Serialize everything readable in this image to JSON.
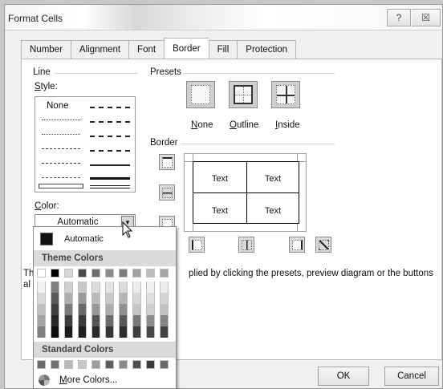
{
  "window": {
    "title": "Format Cells",
    "help_glyph": "?",
    "close_glyph": "☒"
  },
  "tabs": [
    "Number",
    "Alignment",
    "Font",
    "Border",
    "Fill",
    "Protection"
  ],
  "line": {
    "section": "Line",
    "style_label": "Style:",
    "none_label": "None",
    "color_label": "Color:",
    "color_value": "Automatic"
  },
  "presets": {
    "section": "Presets",
    "items": [
      {
        "label_u": "N",
        "label_rest": "one"
      },
      {
        "label_u": "O",
        "label_rest": "utline"
      },
      {
        "label_u": "I",
        "label_rest": "nside"
      }
    ]
  },
  "border": {
    "section": "Border",
    "cells": [
      "Text",
      "Text",
      "Text",
      "Text"
    ]
  },
  "footnote": {
    "left_visible": "Th",
    "left_visible2": "al",
    "text": "plied by clicking the presets, preview diagram or the buttons"
  },
  "buttons": {
    "ok": "OK",
    "cancel": "Cancel"
  },
  "palette": {
    "automatic_label": "Automatic",
    "theme_header": "Theme Colors",
    "standard_header": "Standard Colors",
    "more_u": "M",
    "more_rest": "ore Colors...",
    "theme_top_row": [
      "#ffffff",
      "#000000",
      "#d8d8d8",
      "#4a4a4a",
      "#6e6e6e",
      "#8c8c8c",
      "#7a7a7a",
      "#a2a2a2",
      "#bcbcbc",
      "#a6a6a6"
    ],
    "theme_columns": [
      [
        "#f2f2f2",
        "#d9d9d9",
        "#bfbfbf",
        "#a6a6a6",
        "#7f7f7f"
      ],
      [
        "#7f7f7f",
        "#595959",
        "#3f3f3f",
        "#262626",
        "#0d0d0d"
      ],
      [
        "#d0d0d0",
        "#aeaeae",
        "#7a7a7a",
        "#3d3d3d",
        "#1a1a1a"
      ],
      [
        "#c8c8c8",
        "#9a9a9a",
        "#6a6a6a",
        "#3a3a3a",
        "#1e1e1e"
      ],
      [
        "#dcdcdc",
        "#bababa",
        "#979797",
        "#555555",
        "#2a2a2a"
      ],
      [
        "#e4e4e4",
        "#c9c9c9",
        "#adadad",
        "#6c6c6c",
        "#363636"
      ],
      [
        "#dadada",
        "#b5b5b5",
        "#909090",
        "#5a5a5a",
        "#2d2d2d"
      ],
      [
        "#ececec",
        "#d8d8d8",
        "#c5c5c5",
        "#7a7a7a",
        "#3e3e3e"
      ],
      [
        "#f0f0f0",
        "#e0e0e0",
        "#d0d0d0",
        "#8c8c8c",
        "#464646"
      ],
      [
        "#ebebeb",
        "#d6d6d6",
        "#c2c2c2",
        "#858585",
        "#424242"
      ]
    ],
    "standard_row": [
      "#6a6a6a",
      "#707070",
      "#b8b8b8",
      "#c8c8c8",
      "#9c9c9c",
      "#5c5c5c",
      "#8a8a8a",
      "#4e4e4e",
      "#3a3a3a",
      "#6a6a6a"
    ]
  }
}
